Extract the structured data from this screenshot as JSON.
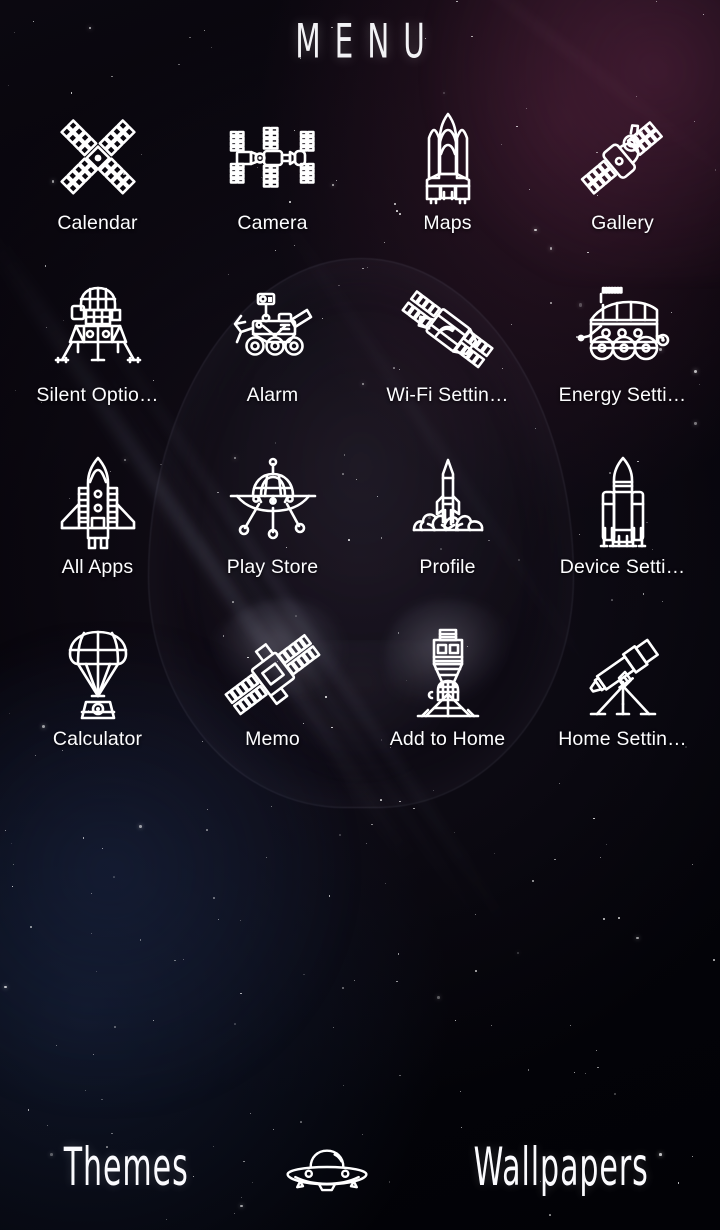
{
  "header": {
    "title": "MENU"
  },
  "theme": {
    "background_color": "#050406",
    "icon_color": "#ffffff",
    "label_color": "#fdfdff",
    "accent_glow": "#b9c3e1"
  },
  "apps": [
    {
      "label": "Calendar",
      "icon": "satellite-x-panels-icon"
    },
    {
      "label": "Camera",
      "icon": "space-station-horizontal-icon"
    },
    {
      "label": "Maps",
      "icon": "space-shuttle-launch-stack-icon"
    },
    {
      "label": "Gallery",
      "icon": "satellite-diagonal-icon"
    },
    {
      "label": "Silent Optio…",
      "icon": "lunar-lander-icon"
    },
    {
      "label": "Alarm",
      "icon": "mars-rover-icon"
    },
    {
      "label": "Wi-Fi Settin…",
      "icon": "space-probe-diagonal-icon"
    },
    {
      "label": "Energy Setti…",
      "icon": "moon-buggy-rover-icon"
    },
    {
      "label": "All Apps",
      "icon": "shuttle-orbiter-front-icon"
    },
    {
      "label": "Play Store",
      "icon": "ufo-saucer-legs-icon"
    },
    {
      "label": "Profile",
      "icon": "rocket-liftoff-smoke-icon"
    },
    {
      "label": "Device Setti…",
      "icon": "rocket-boosters-tall-icon"
    },
    {
      "label": "Calculator",
      "icon": "parachute-capsule-icon"
    },
    {
      "label": "Memo",
      "icon": "satellite-solar-arrays-icon"
    },
    {
      "label": "Add to Home",
      "icon": "lunar-module-icon"
    },
    {
      "label": "Home Settin…",
      "icon": "telescope-tripod-icon"
    }
  ],
  "dock": {
    "left_label": "Themes",
    "center_icon": "ufo-saucer-icon",
    "right_label": "Wallpapers"
  }
}
